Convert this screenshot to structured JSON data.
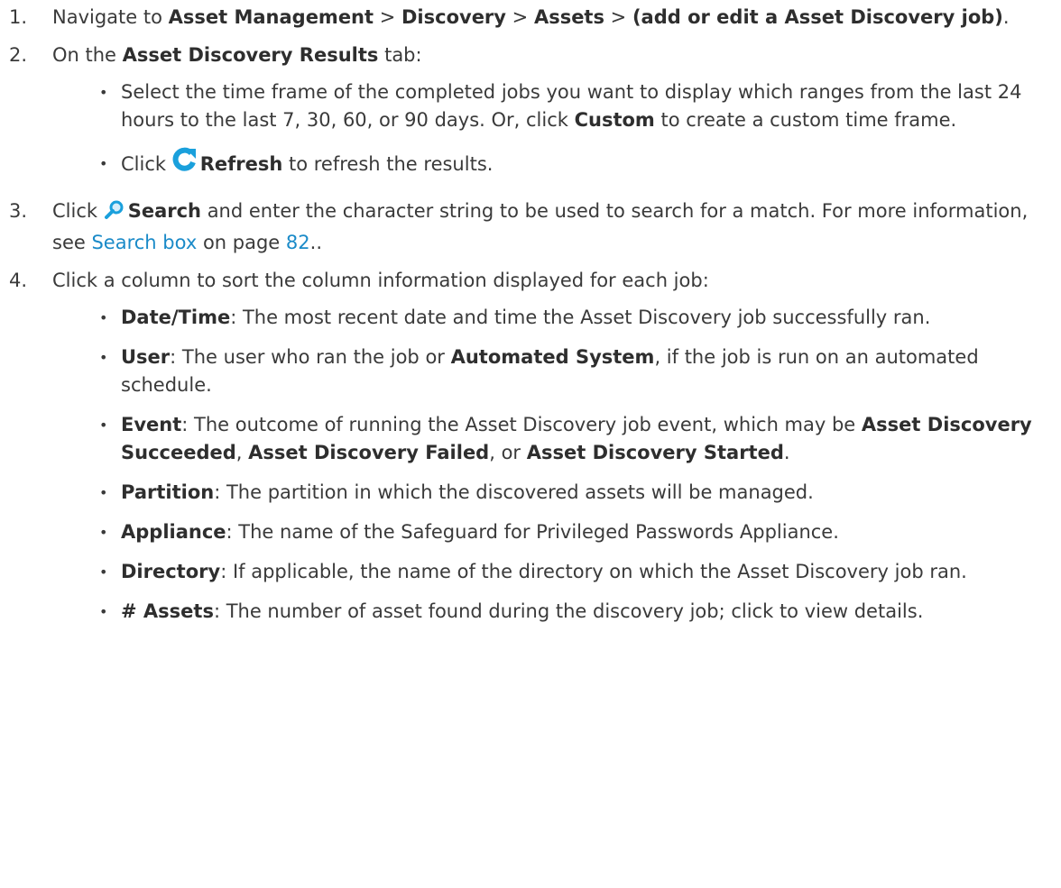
{
  "steps": [
    {
      "num": "1.",
      "t1": "Navigate to ",
      "b1": "Asset Management",
      "sep1": " > ",
      "b2": "Discovery",
      "sep2": " > ",
      "b3": "Assets",
      "sep3": " > ",
      "b4": "(add or edit a Asset Discovery job)",
      "t_end": "."
    },
    {
      "num": "2.",
      "t1": "On the ",
      "b1": "Asset Discovery Results",
      "t2": " tab:",
      "bullets": [
        {
          "t1": "Select the time frame of the completed jobs you want to display which ranges from the last 24 hours to the last 7, 30, 60, or 90 days. Or, click ",
          "b1": "Custom",
          "t2": " to create a custom time frame."
        },
        {
          "t1": "Click ",
          "icon": "refresh-icon",
          "b1": "Refresh",
          "t2": "  to refresh the results."
        }
      ]
    },
    {
      "num": "3.",
      "t1": "Click ",
      "icon": "search-icon",
      "b1": "Search",
      "t2": " and enter the character string to be used to search for a match. For more information, see ",
      "link": "Search box",
      "t3": " on page ",
      "page_link": "82",
      "t4": ".."
    },
    {
      "num": "4.",
      "t1": "Click a column to sort the column information displayed for each job:",
      "columns": [
        {
          "name": "Date/Time",
          "desc": ": The most recent date and time the Asset Discovery job successfully ran."
        },
        {
          "name": "User",
          "desc": ": The user who ran the job or ",
          "b2": "Automated System",
          "desc2": ", if the job is run on an automated schedule."
        },
        {
          "name": "Event",
          "desc": ": The outcome of running the Asset Discovery job event, which may be ",
          "b2": "Asset Discovery Succeeded",
          "desc2": ", ",
          "b3": "Asset Discovery Failed",
          "desc3": ", or ",
          "b4": "Asset Discovery Started",
          "desc4": "."
        },
        {
          "name": "Partition",
          "desc": ": The partition in which the discovered assets will be managed."
        },
        {
          "name": "Appliance",
          "desc": ": The name of the Safeguard for Privileged Passwords Appliance."
        },
        {
          "name": "Directory",
          "desc": ": If applicable, the name of the directory on which the Asset Discovery job ran."
        },
        {
          "name": "# Assets",
          "desc": ": The number of asset found during the discovery job; click to view details."
        }
      ]
    }
  ],
  "bullet_char": "•",
  "colors": {
    "text": "#3a3a3a",
    "link": "#1a8ac8",
    "icon_blue": "#1aa0dc"
  }
}
